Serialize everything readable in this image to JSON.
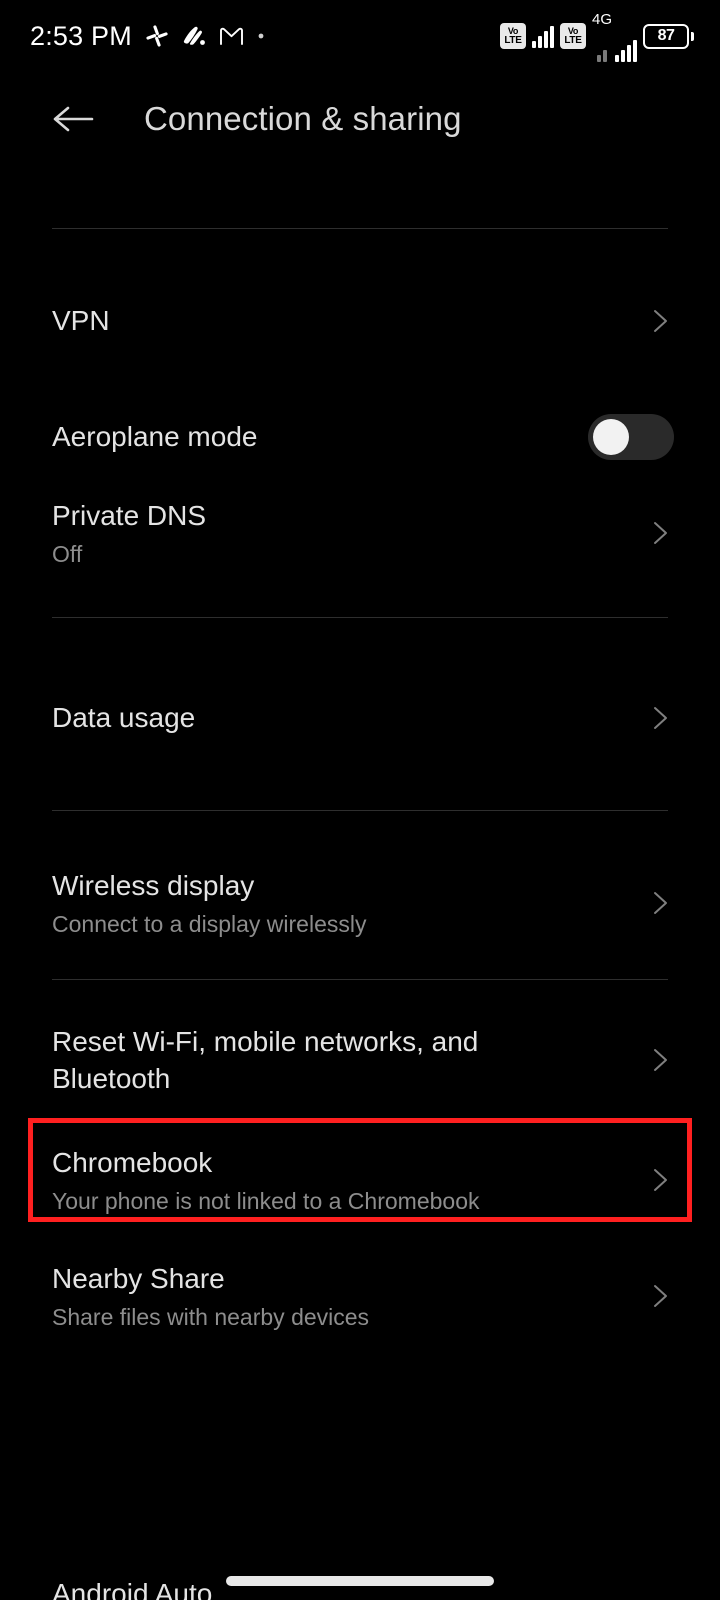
{
  "status_bar": {
    "time": "2:53 PM",
    "left_icons": [
      "slack-icon",
      "media-app-icon",
      "gmail-icon",
      "dot-icon"
    ],
    "volte_label_top": "Vo",
    "volte_label_bottom": "LTE",
    "network_type": "4G",
    "battery_percent": "87",
    "right_icons": [
      "volte-badge-sim1",
      "signal-bars-sim1",
      "volte-badge-sim2",
      "signal-bars-sim2",
      "battery-icon"
    ]
  },
  "app_bar": {
    "back_icon": "arrow-left-icon",
    "title": "Connection & sharing"
  },
  "list": {
    "items": [
      {
        "title": "VPN",
        "subtitle": "",
        "accessory": "chevron"
      },
      {
        "title": "Aeroplane mode",
        "subtitle": "",
        "accessory": "toggle",
        "toggle_on": false
      },
      {
        "title": "Private DNS",
        "subtitle": "Off",
        "accessory": "chevron"
      },
      {
        "title": "Data usage",
        "subtitle": "",
        "accessory": "chevron"
      },
      {
        "title": "Wireless display",
        "subtitle": "Connect to a display wirelessly",
        "accessory": "chevron"
      },
      {
        "title": "Reset Wi-Fi, mobile networks, and Bluetooth",
        "subtitle": "",
        "accessory": "chevron",
        "highlighted": true
      },
      {
        "title": "Chromebook",
        "subtitle": "Your phone is not linked to a Chromebook",
        "accessory": "chevron"
      },
      {
        "title": "Nearby Share",
        "subtitle": "Share files with nearby devices",
        "accessory": "chevron"
      },
      {
        "title": "Android Auto",
        "subtitle": "",
        "accessory": "chevron"
      }
    ]
  },
  "colors": {
    "background": "#000000",
    "title_text": "#e4e4e4",
    "subtitle_text": "#8d8d8d",
    "divider": "#2e2e2e",
    "highlight_border": "#ff2020",
    "toggle_track": "#2a2a2a",
    "toggle_knob": "#f2f2f2"
  }
}
